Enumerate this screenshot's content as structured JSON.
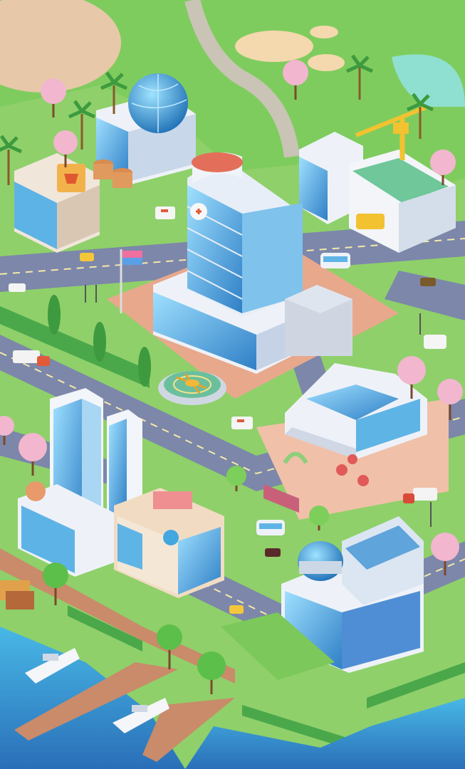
{
  "scene": {
    "type": "isometric-city-map",
    "visible_text": [],
    "colors": {
      "grass": "#7cc85a",
      "grass_dark": "#4fa84a",
      "road": "#7b86a8",
      "plaza": "#e8a890",
      "water": "#3aa7d8",
      "glass": "#5fb8ea",
      "cherry_blossom": "#f2b6cf",
      "dock": "#c98b6a"
    }
  },
  "buildings": [
    {
      "name": "hospital-tower",
      "icon": "hospital-cross-icon"
    },
    {
      "name": "dome-observatory"
    },
    {
      "name": "shop-with-billboard"
    },
    {
      "name": "construction-site"
    },
    {
      "name": "twin-glass-towers"
    },
    {
      "name": "clinic-building"
    },
    {
      "name": "research-center"
    },
    {
      "name": "wing-building"
    }
  ],
  "vehicles": [
    "ambulance",
    "helicopter",
    "bus",
    "truck",
    "taxi",
    "car",
    "yacht"
  ]
}
